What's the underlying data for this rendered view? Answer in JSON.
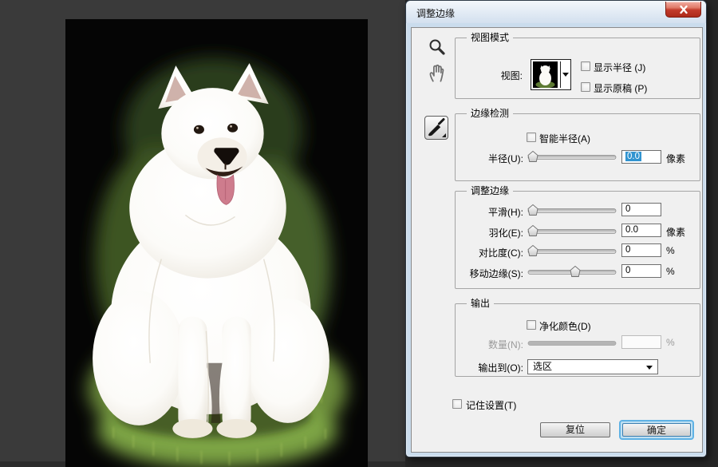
{
  "window": {
    "title": "调整边缘"
  },
  "colors": {
    "selection_highlight": "#3194d0",
    "close_button_red": "#c23b2b",
    "focus_ring_blue": "#5fb2e5",
    "canvas_background": "#3a3a3a",
    "dialog_frame": "#cadced",
    "panel_background": "#f0f0f0",
    "grass_green": "#6c8c3a"
  },
  "tools": {
    "zoom_icon": "magnifier",
    "hand_icon": "hand",
    "refine_radius_tool_icon": "brush"
  },
  "dialog": {
    "view_mode": {
      "legend": "视图模式",
      "view_label": "视图:",
      "show_radius_label": "显示半径 (J)",
      "show_original_label": "显示原稿 (P)"
    },
    "edge_detection": {
      "legend": "边缘检测",
      "smart_radius_label": "智能半径(A)",
      "radius_label": "半径(U):",
      "radius_value": "0.0",
      "radius_unit": "像素"
    },
    "adjust_edge": {
      "legend": "调整边缘",
      "rows": [
        {
          "label": "平滑(H):",
          "value": "0",
          "unit": ""
        },
        {
          "label": "羽化(E):",
          "value": "0.0",
          "unit": "像素"
        },
        {
          "label": "对比度(C):",
          "value": "0",
          "unit": "%"
        },
        {
          "label": "移动边缘(S):",
          "value": "0",
          "unit": "%"
        }
      ]
    },
    "output": {
      "legend": "输出",
      "decontaminate_label": "净化颜色(D)",
      "amount_label": "数量(N):",
      "amount_value": "",
      "amount_unit": "%",
      "output_to_label": "输出到(O):",
      "output_to_value": "选区"
    },
    "remember_label": "记住设置(T)",
    "buttons": {
      "reset": "复位",
      "ok": "确定"
    }
  }
}
